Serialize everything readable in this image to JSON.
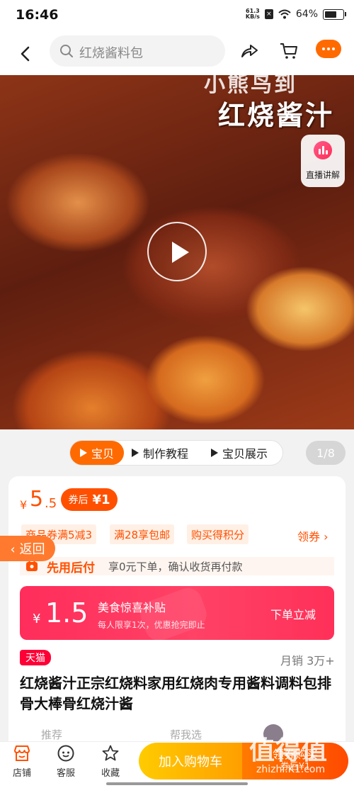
{
  "status_bar": {
    "time": "16:46",
    "net_speed_top": "61.3",
    "net_speed_bottom": "KB/s",
    "battery": "64%"
  },
  "nav": {
    "search_text": "红烧酱料包",
    "icons": [
      "back-icon",
      "search-icon",
      "share-icon",
      "cart-icon",
      "more-icon"
    ]
  },
  "hero": {
    "overlay_line_1": "小熊鸟到",
    "overlay_line_2": "红烧酱汁",
    "live_label": "直播讲解"
  },
  "media_tabs": {
    "tabs": [
      "宝贝",
      "制作教程",
      "宝贝展示"
    ],
    "active_index": 0,
    "counter": "1/8"
  },
  "price": {
    "symbol": "¥",
    "integer": "5",
    "decimal": ".5",
    "after_coupon_label": "券后",
    "after_coupon_value": "¥1"
  },
  "promos": {
    "chips": [
      "商品券满5减3",
      "满28享包邮",
      "购买得积分"
    ],
    "coupon_link": "领券 ›"
  },
  "return_button": "‹ 返回",
  "pay_later": {
    "title": "先用后付",
    "desc": "享0元下单，确认收货再付款"
  },
  "subsidy_banner": {
    "symbol": "¥",
    "price": "1.5",
    "title": "美食惊喜补贴",
    "subtitle": "每人限享1次，优惠抢完即止",
    "cta": "下单立减"
  },
  "product": {
    "store_tag": "天猫",
    "monthly_sales": "月销 3万+",
    "title": "红烧酱汁正宗红烧料家用红烧肉专用酱料调料包排骨大棒骨红烧汁酱",
    "peek_left": "推荐",
    "peek_mid": "帮我选"
  },
  "bottom_bar": {
    "shop": "店铺",
    "service": "客服",
    "favorite": "收藏",
    "add_to_cart": "加入购物车",
    "buy_now": "领券购买",
    "buy_sub": "券后¥1"
  },
  "watermark": {
    "text": "值得值",
    "url": "zhizhi.K1.com"
  },
  "colors": {
    "brand_orange": "#ff5000",
    "cart_yellow": "#ffb800",
    "subsidy_pink": "#ff2d5b",
    "tmall_red": "#ff0036"
  }
}
